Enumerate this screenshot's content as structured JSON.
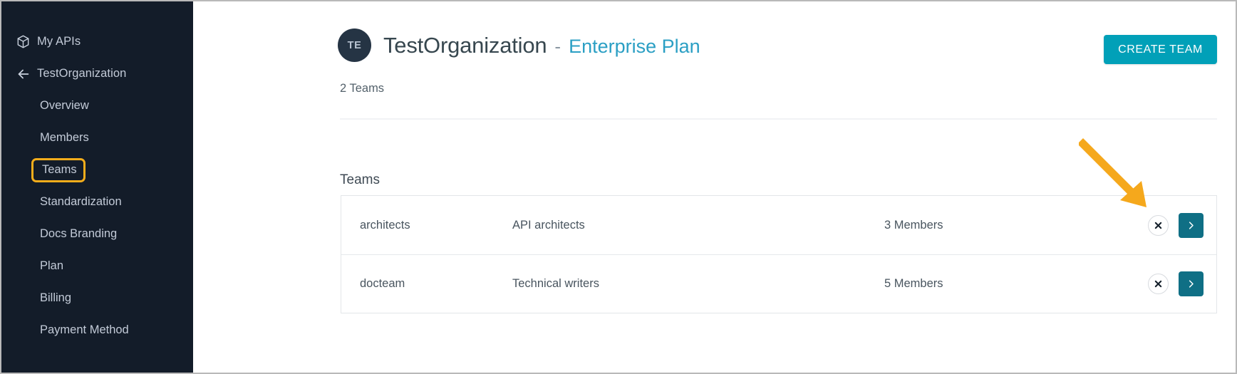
{
  "colors": {
    "sidebar_bg": "#131c29",
    "accent_teal": "#01a0b8",
    "row_action_teal": "#0f6f85",
    "plan_link": "#2b9fc4",
    "highlight_orange": "#f4ad1b",
    "annotation_orange": "#f5a81c"
  },
  "sidebar": {
    "items": [
      {
        "label": "My APIs",
        "icon": "cube-icon",
        "level": "top"
      },
      {
        "label": "TestOrganization",
        "icon": "arrow-left-icon",
        "level": "top"
      },
      {
        "label": "Overview",
        "level": "sub"
      },
      {
        "label": "Members",
        "level": "sub"
      },
      {
        "label": "Teams",
        "level": "sub",
        "highlighted": true
      },
      {
        "label": "Standardization",
        "level": "sub"
      },
      {
        "label": "Docs Branding",
        "level": "sub"
      },
      {
        "label": "Plan",
        "level": "sub"
      },
      {
        "label": "Billing",
        "level": "sub"
      },
      {
        "label": "Payment Method",
        "level": "sub"
      }
    ]
  },
  "header": {
    "avatar_initials": "TE",
    "org_name": "TestOrganization",
    "separator": "-",
    "plan_name": "Enterprise Plan",
    "create_team_label": "CREATE TEAM"
  },
  "main": {
    "team_count_label": "2 Teams",
    "teams_section_label": "Teams"
  },
  "teams": [
    {
      "name": "architects",
      "description": "API architects",
      "members": "3 Members",
      "remove_icon": "close-x-icon",
      "open_icon": "chevron-right-icon",
      "hovered": true
    },
    {
      "name": "docteam",
      "description": "Technical writers",
      "members": "5 Members",
      "remove_icon": "close-x-icon",
      "open_icon": "chevron-right-icon",
      "hovered": false
    }
  ],
  "annotation": {
    "type": "arrow",
    "points_to": "remove-team-button-row-1"
  }
}
